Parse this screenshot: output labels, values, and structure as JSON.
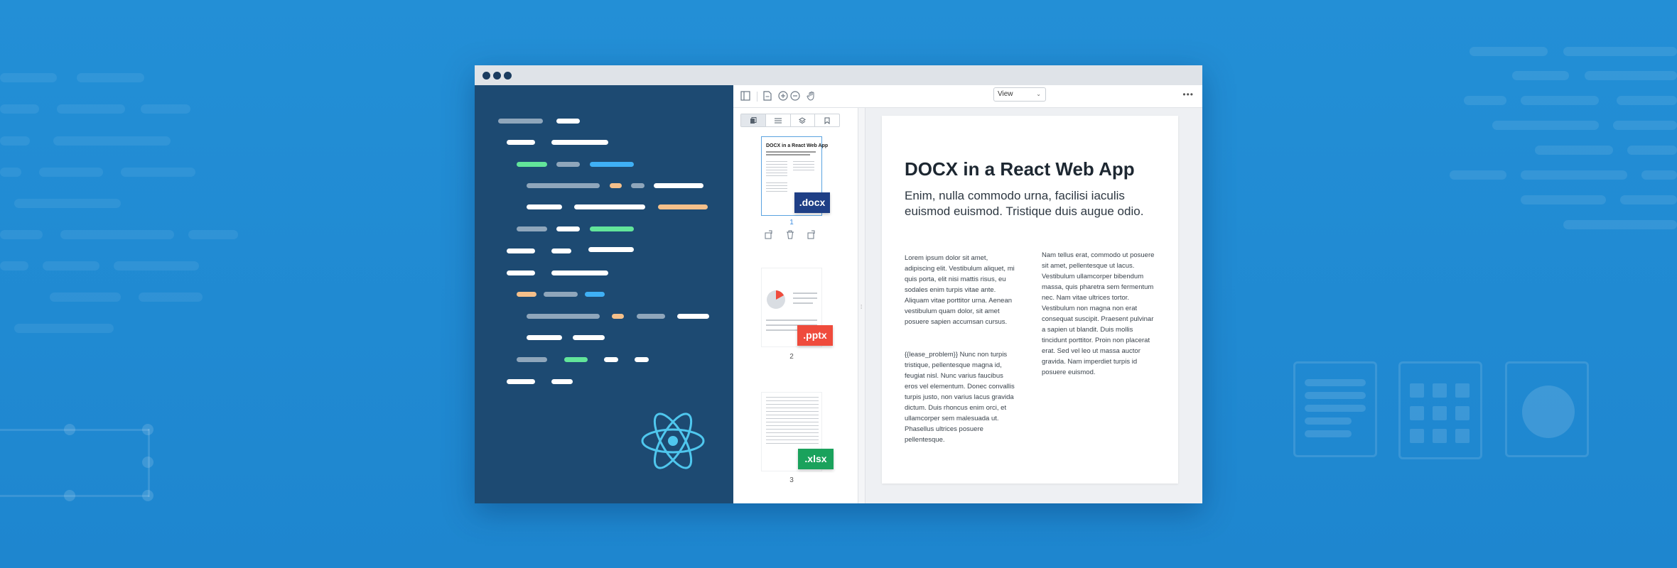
{
  "window": {
    "controls": [
      "close",
      "minimize",
      "maximize"
    ]
  },
  "toolbar": {
    "icons": [
      "sidebar-toggle-icon",
      "document-icon",
      "zoom-in-icon",
      "zoom-out-icon",
      "pan-hand-icon"
    ],
    "view_select": "View",
    "more_label": "•••"
  },
  "thumbnail_tabs": [
    "thumbnails-tab",
    "outline-tab",
    "layers-tab",
    "bookmarks-tab"
  ],
  "thumbnails": [
    {
      "page": "1",
      "badge": ".docx",
      "title": "DOCX in a React Web App"
    },
    {
      "page": "2",
      "badge": ".pptx"
    },
    {
      "page": "3",
      "badge": ".xlsx"
    }
  ],
  "document": {
    "title": "DOCX in a React Web App",
    "subtitle": "Enim, nulla commodo urna, facilisi iaculis euismod euismod. Tristique duis augue odio.",
    "col1_p1": "Lorem ipsum dolor sit amet, adipiscing elit. Vestibulum aliquet, mi quis porta, elit nisi mattis risus, eu sodales enim turpis vitae ante. Aliquam vitae porttitor urna. Aenean vestibulum quam dolor, sit amet posuere sapien accumsan cursus.",
    "col1_p2": "{{lease_problem}} Nunc non turpis tristique, pellentesque magna id, feugiat nisl. Nunc varius faucibus eros vel elementum. Donec convallis turpis justo, non varius lacus gravida dictum. Duis rhoncus enim orci, et ullamcorper sem malesuada ut. Phasellus ultrices posuere pellentesque.",
    "col2_p1": "Nam tellus erat, commodo ut posuere sit amet, pellentesque ut lacus. Vestibulum ullamcorper bibendum massa, quis pharetra sem fermentum nec. Nam vitae ultrices tortor. Vestibulum non magna non erat consequat suscipit. Praesent pulvinar a sapien ut blandit. Duis mollis tincidunt porttitor. Proin non placerat erat. Sed vel leo ut massa auctor gravida. Nam imperdiet turpis id posuere euismod."
  },
  "colors": {
    "background": "#238fd6",
    "code_pane": "#1d4a72",
    "docx_badge": "#1f3f86",
    "pptx_badge": "#ef4b3c",
    "xlsx_badge": "#1aa25c",
    "react": "#4fc7ee"
  }
}
